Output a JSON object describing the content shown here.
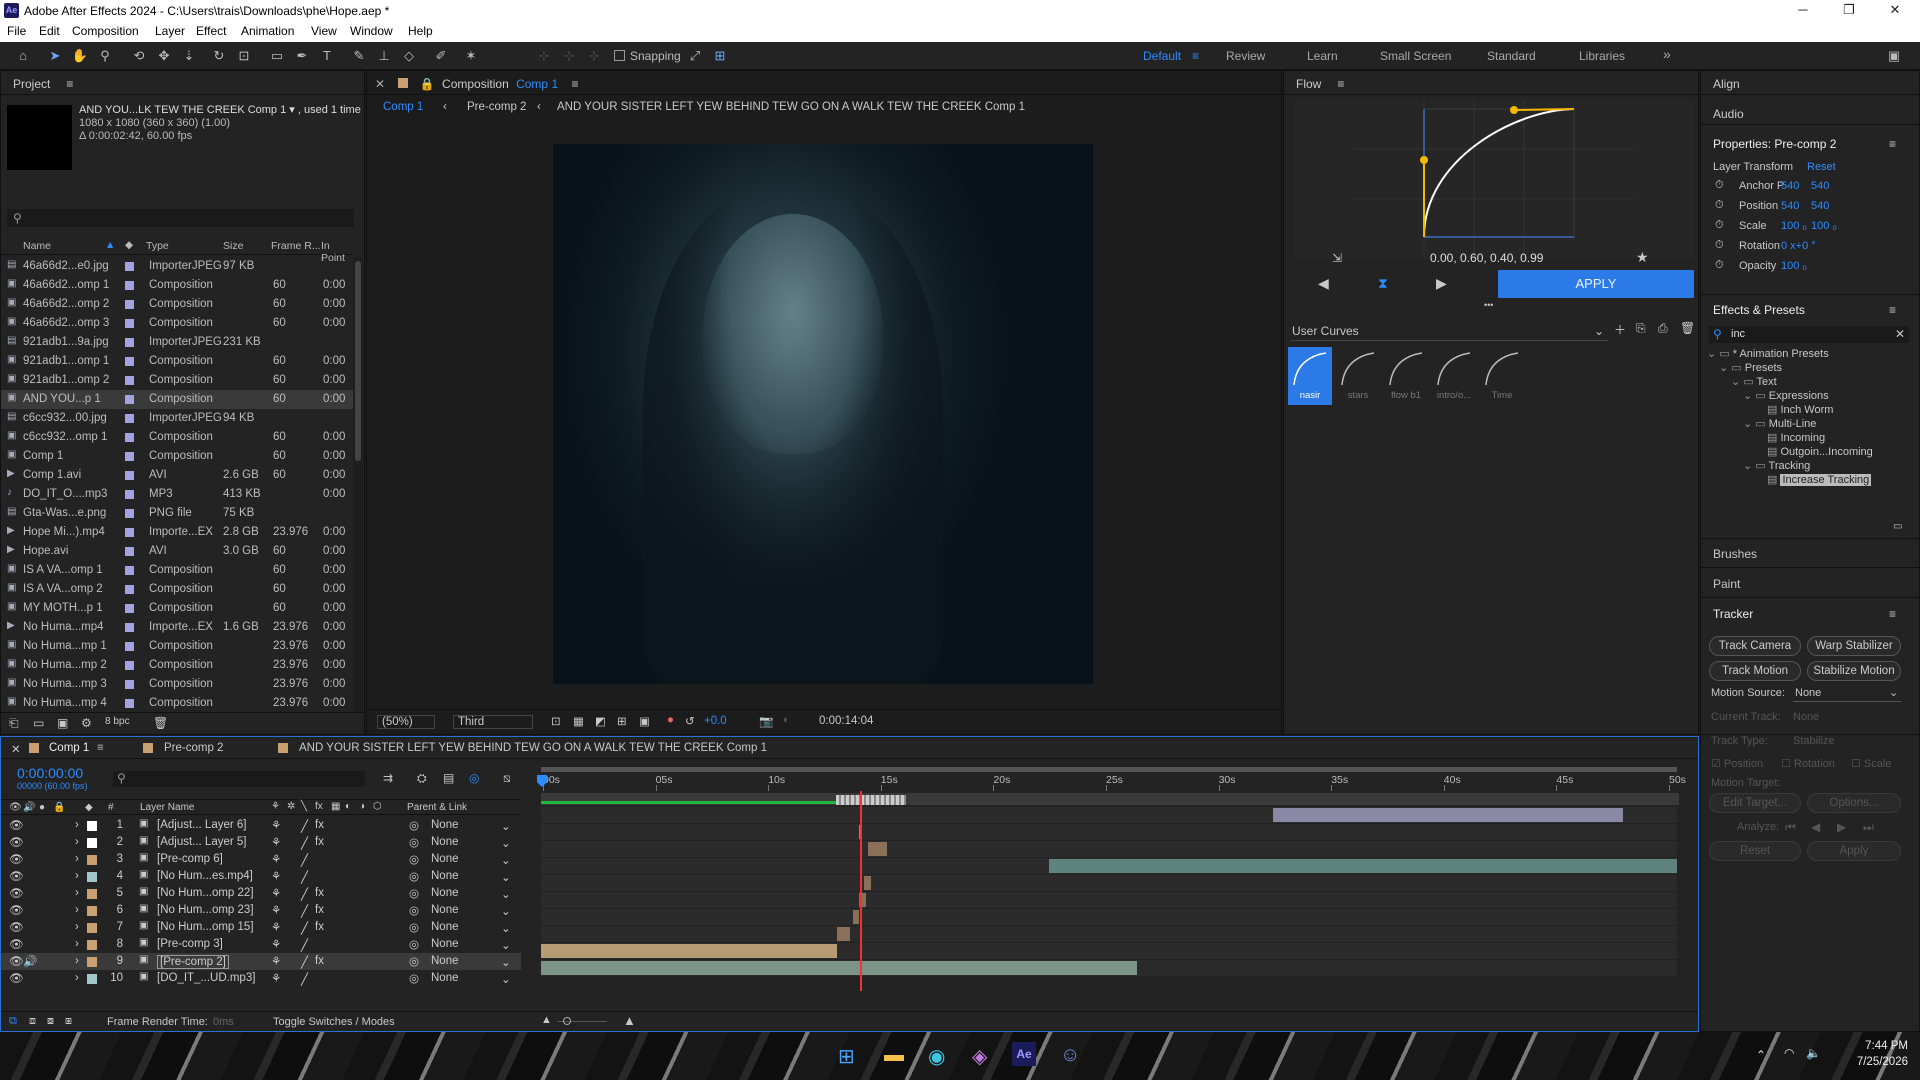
{
  "window": {
    "title": "Adobe After Effects 2024 - C:\\Users\\trais\\Downloads\\phe\\Hope.aep *",
    "app_icon": "Ae"
  },
  "menu": [
    "File",
    "Edit",
    "Composition",
    "Layer",
    "Effect",
    "Animation",
    "View",
    "Window",
    "Help"
  ],
  "toolbar": {
    "snapping": "Snapping",
    "workspaces": [
      "Default",
      "Review",
      "Learn",
      "Small Screen",
      "Standard",
      "Libraries"
    ],
    "more": "»"
  },
  "project": {
    "title": "Project",
    "selected_name": "AND YOU...LK TEW THE CREEK Comp 1 ▾ , used 1 time",
    "selected_info1": "1080 x 1080  (360 x 360) (1.00)",
    "selected_info2": "Δ 0:00:02:42, 60.00 fps",
    "search_placeholder": "",
    "columns": [
      "Name",
      "Type",
      "Size",
      "Frame R...",
      "In Point"
    ],
    "bpc": "8 bpc",
    "items": [
      {
        "name": "46a66d2...e0.jpg",
        "type": "ImporterJPEG",
        "size": "97 KB",
        "fps": "",
        "in": "",
        "color": "#a3a3e0",
        "icon": "image-icon"
      },
      {
        "name": "46a66d2...omp 1",
        "type": "Composition",
        "size": "",
        "fps": "60",
        "in": "0:00",
        "color": "#a3a3e0",
        "icon": "composition-icon"
      },
      {
        "name": "46a66d2...omp 2",
        "type": "Composition",
        "size": "",
        "fps": "60",
        "in": "0:00",
        "color": "#a3a3e0",
        "icon": "composition-icon"
      },
      {
        "name": "46a66d2...omp 3",
        "type": "Composition",
        "size": "",
        "fps": "60",
        "in": "0:00",
        "color": "#a3a3e0",
        "icon": "composition-icon"
      },
      {
        "name": "921adb1...9a.jpg",
        "type": "ImporterJPEG",
        "size": "231 KB",
        "fps": "",
        "in": "",
        "color": "#a3a3e0",
        "icon": "image-icon"
      },
      {
        "name": "921adb1...omp 1",
        "type": "Composition",
        "size": "",
        "fps": "60",
        "in": "0:00",
        "color": "#a3a3e0",
        "icon": "composition-icon"
      },
      {
        "name": "921adb1...omp 2",
        "type": "Composition",
        "size": "",
        "fps": "60",
        "in": "0:00",
        "color": "#a3a3e0",
        "icon": "composition-icon"
      },
      {
        "name": "AND YOU...p 1",
        "type": "Composition",
        "size": "",
        "fps": "60",
        "in": "0:00",
        "color": "#a3a3e0",
        "icon": "composition-icon"
      },
      {
        "name": "c6cc932...00.jpg",
        "type": "ImporterJPEG",
        "size": "94 KB",
        "fps": "",
        "in": "",
        "color": "#a3a3e0",
        "icon": "image-icon"
      },
      {
        "name": "c6cc932...omp 1",
        "type": "Composition",
        "size": "",
        "fps": "60",
        "in": "0:00",
        "color": "#a3a3e0",
        "icon": "composition-icon"
      },
      {
        "name": "Comp 1",
        "type": "Composition",
        "size": "",
        "fps": "60",
        "in": "0:00",
        "color": "#a3a3e0",
        "icon": "composition-icon"
      },
      {
        "name": "Comp 1.avi",
        "type": "AVI",
        "size": "2.6 GB",
        "fps": "60",
        "in": "0:00",
        "color": "#a3a3e0",
        "icon": "video-icon"
      },
      {
        "name": "DO_IT_O....mp3",
        "type": "MP3",
        "size": "413 KB",
        "fps": "",
        "in": "0:00",
        "color": "#a3a3e0",
        "icon": "audio-icon"
      },
      {
        "name": "Gta-Was...e.png",
        "type": "PNG file",
        "size": "75 KB",
        "fps": "",
        "in": "",
        "color": "#a3a3e0",
        "icon": "image-icon"
      },
      {
        "name": "Hope Mi...).mp4",
        "type": "Importe...EX",
        "size": "2.8 GB",
        "fps": "23.976",
        "in": "0:00",
        "color": "#a3a3e0",
        "icon": "video-icon"
      },
      {
        "name": "Hope.avi",
        "type": "AVI",
        "size": "3.0 GB",
        "fps": "60",
        "in": "0:00",
        "color": "#a3a3e0",
        "icon": "video-icon"
      },
      {
        "name": "IS A VA...omp 1",
        "type": "Composition",
        "size": "",
        "fps": "60",
        "in": "0:00",
        "color": "#a3a3e0",
        "icon": "composition-icon"
      },
      {
        "name": "IS A VA...omp 2",
        "type": "Composition",
        "size": "",
        "fps": "60",
        "in": "0:00",
        "color": "#a3a3e0",
        "icon": "composition-icon"
      },
      {
        "name": "MY MOTH...p 1",
        "type": "Composition",
        "size": "",
        "fps": "60",
        "in": "0:00",
        "color": "#a3a3e0",
        "icon": "composition-icon"
      },
      {
        "name": "No Huma...mp4",
        "type": "Importe...EX",
        "size": "1.6 GB",
        "fps": "23.976",
        "in": "0:00",
        "color": "#a3a3e0",
        "icon": "video-icon"
      },
      {
        "name": "No Huma...mp 1",
        "type": "Composition",
        "size": "",
        "fps": "23.976",
        "in": "0:00",
        "color": "#a3a3e0",
        "icon": "composition-icon"
      },
      {
        "name": "No Huma...mp 2",
        "type": "Composition",
        "size": "",
        "fps": "23.976",
        "in": "0:00",
        "color": "#a3a3e0",
        "icon": "composition-icon"
      },
      {
        "name": "No Huma...mp 3",
        "type": "Composition",
        "size": "",
        "fps": "23.976",
        "in": "0:00",
        "color": "#a3a3e0",
        "icon": "composition-icon"
      },
      {
        "name": "No Huma...mp 4",
        "type": "Composition",
        "size": "",
        "fps": "23.976",
        "in": "0:00",
        "color": "#a3a3e0",
        "icon": "composition-icon"
      }
    ]
  },
  "composition": {
    "label": "Composition",
    "name": "Comp 1",
    "breadcrumbs": [
      "Comp 1",
      "Pre-comp 2",
      "AND YOUR SISTER LEFT YEW BEHIND TEW GO ON A WALK TEW THE CREEK Comp 1"
    ],
    "zoom": "(50%)",
    "resolution": "Third",
    "exposure": "+0.0",
    "timecode": "0:00:14:04"
  },
  "flow": {
    "title": "Flow",
    "values": "0.00, 0.60, 0.40, 0.99",
    "apply": "APPLY",
    "dots": "•••",
    "curves_label": "User Curves",
    "presets": [
      "nasir",
      "stars",
      "flow b1",
      "intro/o...",
      "Time"
    ]
  },
  "right": {
    "align": "Align",
    "audio": "Audio",
    "properties_title": "Properties: Pre-comp 2",
    "layer_transform": "Layer Transform",
    "reset": "Reset",
    "props": [
      {
        "label": "Anchor P",
        "v1": "540",
        "v2": "540"
      },
      {
        "label": "Position",
        "v1": "540",
        "v2": "540"
      },
      {
        "label": "Scale",
        "v1": "100 ₀",
        "v2": "100 ₀"
      },
      {
        "label": "Rotation",
        "v1": "0 x+0 °",
        "v2": ""
      },
      {
        "label": "Opacity",
        "v1": "100 ₀",
        "v2": ""
      }
    ],
    "effects_title": "Effects & Presets",
    "effects_search": "inc",
    "tree": [
      "* Animation Presets",
      "Presets",
      "Text",
      "Expressions",
      "Inch Worm",
      "Multi-Line",
      "Incoming",
      "Outgoin...Incoming",
      "Tracking",
      "Increase Tracking"
    ],
    "brushes": "Brushes",
    "paint": "Paint",
    "tracker": "Tracker",
    "tracker_buttons": [
      "Track Camera",
      "Warp Stabilizer",
      "Track Motion",
      "Stabilize Motion"
    ],
    "motion_source_label": "Motion Source:",
    "motion_source": "None",
    "current_track_label": "Current Track:",
    "current_track": "None",
    "track_type_label": "Track Type:",
    "track_type": "Stabilize",
    "checks": [
      "Position",
      "Rotation",
      "Scale"
    ],
    "motion_target": "Motion Target:",
    "edit_target": "Edit Target...",
    "options": "Options...",
    "analyze": "Analyze:",
    "reset2": "Reset",
    "apply2": "Apply"
  },
  "timeline": {
    "tabs": [
      "Comp 1",
      "Pre-comp 2",
      "AND YOUR SISTER LEFT YEW BEHIND TEW GO ON A WALK TEW THE CREEK Comp 1"
    ],
    "timecode": "0:00:00:00",
    "fps": "00000 (60.00 fps)",
    "col_num": "#",
    "col_name": "Layer Name",
    "col_parent": "Parent & Link",
    "ruler": [
      "00s",
      "05s",
      "10s",
      "15s",
      "20s",
      "25s",
      "30s",
      "35s",
      "40s",
      "45s",
      "50s"
    ],
    "footer_render": "Frame Render Time:",
    "footer_ms": "0ms",
    "footer_toggle": "Toggle Switches / Modes",
    "layers": [
      {
        "num": "1",
        "name": "[Adjust... Layer 6]",
        "parent": "None",
        "color": "#ffffff",
        "fx": true,
        "bar_start": 32.4,
        "bar_end": 47.9,
        "bar_color": "#8a8aa6"
      },
      {
        "num": "2",
        "name": "[Adjust... Layer 5]",
        "parent": "None",
        "color": "#ffffff",
        "fx": true,
        "bar_start": 14.1,
        "bar_end": 14.2,
        "bar_color": "#8a8aa6"
      },
      {
        "num": "3",
        "name": "[Pre-comp 6]",
        "parent": "None",
        "color": "#c8a072",
        "fx": false,
        "bar_start": 14.5,
        "bar_end": 15.3,
        "bar_color": "#8a7058"
      },
      {
        "num": "4",
        "name": "[No Hum...es.mp4]",
        "parent": "None",
        "color": "#9fc6c9",
        "fx": false,
        "bar_start": 22.5,
        "bar_end": 50.3,
        "bar_color": "#5f8480"
      },
      {
        "num": "5",
        "name": "[No Hum...omp 22]",
        "parent": "None",
        "color": "#c8a072",
        "fx": true,
        "bar_start": 14.3,
        "bar_end": 14.6,
        "bar_color": "#8a7058"
      },
      {
        "num": "6",
        "name": "[No Hum...omp 23]",
        "parent": "None",
        "color": "#c8a072",
        "fx": true,
        "bar_start": 14.1,
        "bar_end": 14.4,
        "bar_color": "#8a7058"
      },
      {
        "num": "7",
        "name": "[No Hum...omp 15]",
        "parent": "None",
        "color": "#c8a072",
        "fx": true,
        "bar_start": 13.8,
        "bar_end": 14.1,
        "bar_color": "#8a7058"
      },
      {
        "num": "8",
        "name": "[Pre-comp 3]",
        "parent": "None",
        "color": "#c8a072",
        "fx": false,
        "bar_start": 13.1,
        "bar_end": 13.7,
        "bar_color": "#8a7058"
      },
      {
        "num": "9",
        "name": "[Pre-comp 2]",
        "parent": "None",
        "color": "#c8a072",
        "fx": true,
        "bar_start": 0,
        "bar_end": 13.1,
        "bar_color": "#b59c74"
      },
      {
        "num": "10",
        "name": "[DO_IT_...UD.mp3]",
        "parent": "None",
        "color": "#9fc6c9",
        "fx": false,
        "bar_start": 0,
        "bar_end": 26.4,
        "bar_color": "#7e938a"
      }
    ]
  },
  "taskbar": {
    "time": "7:44 PM",
    "date": "7/25/2026"
  }
}
